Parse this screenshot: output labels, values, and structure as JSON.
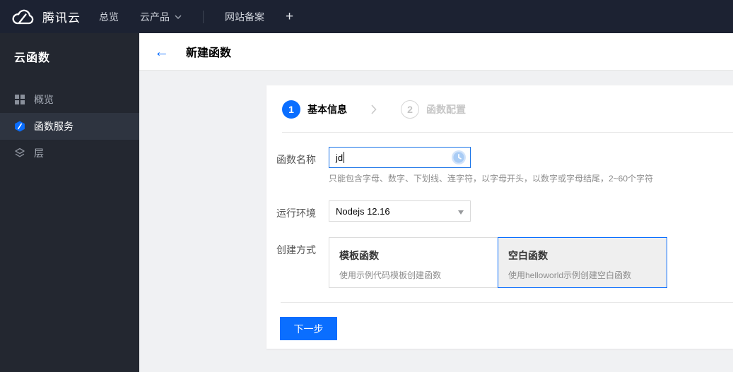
{
  "topbar": {
    "brand": "腾讯云",
    "nav": [
      {
        "label": "总览"
      },
      {
        "label": "云产品",
        "has_caret": true
      },
      {
        "label": "网站备案"
      }
    ],
    "new_tab": "+"
  },
  "sidebar": {
    "title": "云函数",
    "items": [
      {
        "label": "概览",
        "icon": "overview-grid-icon",
        "selected": false
      },
      {
        "label": "函数服务",
        "icon": "function-service-icon",
        "selected": true
      },
      {
        "label": "层",
        "icon": "layers-icon",
        "selected": false
      }
    ]
  },
  "page": {
    "title": "新建函数"
  },
  "steps": {
    "step1": {
      "number": "1",
      "label": "基本信息",
      "state": "active"
    },
    "step2": {
      "number": "2",
      "label": "函数配置",
      "state": "inactive"
    }
  },
  "form": {
    "function_name": {
      "label": "函数名称",
      "value": "jd",
      "help": "只能包含字母、数字、下划线、连字符，以字母开头，以数字或字母结尾，2~60个字符"
    },
    "runtime": {
      "label": "运行环境",
      "value": "Nodejs 12.16"
    },
    "creation_method": {
      "label": "创建方式",
      "options": [
        {
          "title": "模板函数",
          "desc": "使用示例代码模板创建函数",
          "selected": false
        },
        {
          "title": "空白函数",
          "desc": "使用helloworld示例创建空白函数",
          "selected": true
        }
      ]
    }
  },
  "actions": {
    "next": "下一步"
  },
  "icons": {
    "back_arrow": "←"
  },
  "colors": {
    "accent": "#0a6eff",
    "topbar_bg": "#1c2232",
    "sidebar_bg": "#232730",
    "sidebar_selected_bg": "#2e3440",
    "page_bg": "#f0f1f3",
    "selected_card_bg": "#efefef",
    "clock_icon_blue": "#a9ccf5"
  }
}
